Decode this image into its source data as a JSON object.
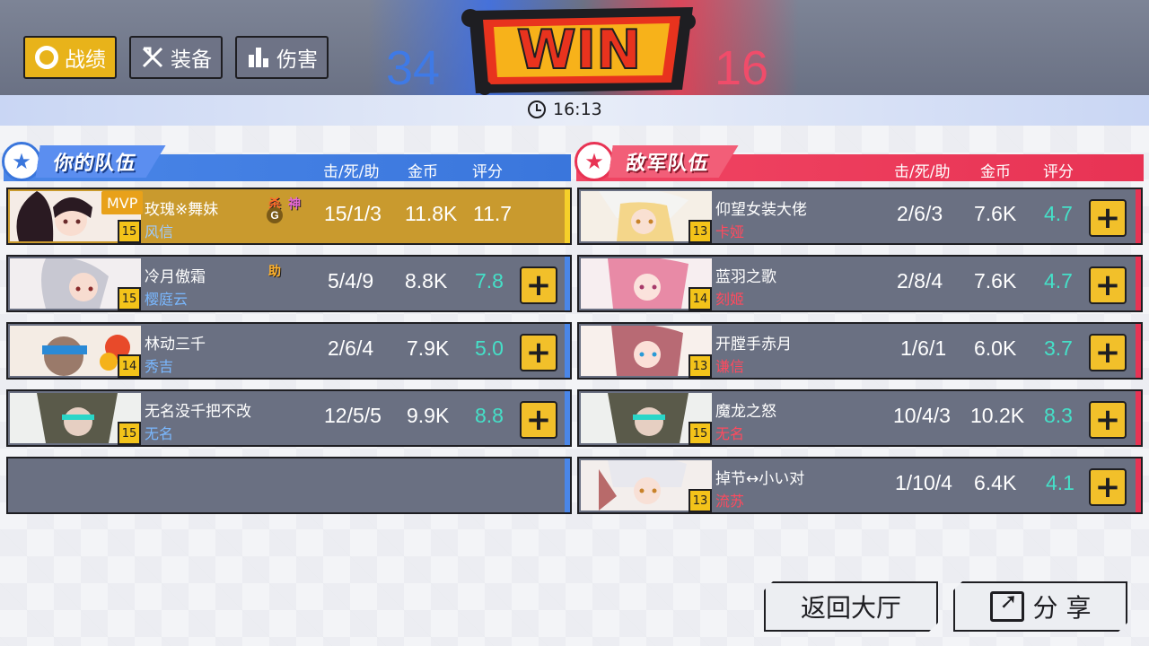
{
  "tabs": [
    {
      "label": "战绩",
      "icon": "ring-icon",
      "active": true
    },
    {
      "label": "装备",
      "icon": "equipment-icon",
      "active": false
    },
    {
      "label": "伤害",
      "icon": "bar-chart-icon",
      "active": false
    }
  ],
  "score": {
    "blue": "34",
    "red": "16",
    "result": "WIN"
  },
  "timer": "16:13",
  "columns": {
    "kda": "击/死/助",
    "gold": "金币",
    "rating": "评分"
  },
  "my_team": {
    "title": "你的队伍",
    "players": [
      {
        "name": "玫瑰※舞妹",
        "hero": "风信",
        "level": "15",
        "kda": "15/1/3",
        "gold": "11.8K",
        "rating": "11.7",
        "mvp": "MVP",
        "badges": [
          "杀",
          "G",
          "神"
        ]
      },
      {
        "name": "冷月傲霜",
        "hero": "樱庭云",
        "level": "15",
        "kda": "5/4/9",
        "gold": "8.8K",
        "rating": "7.8",
        "badges": [
          "助"
        ]
      },
      {
        "name": "林动三千",
        "hero": "秀吉",
        "level": "14",
        "kda": "2/6/4",
        "gold": "7.9K",
        "rating": "5.0",
        "badges": []
      },
      {
        "name": "无名没千把不改",
        "hero": "无名",
        "level": "15",
        "kda": "12/5/5",
        "gold": "9.9K",
        "rating": "8.8",
        "badges": []
      }
    ]
  },
  "enemy_team": {
    "title": "敌军队伍",
    "players": [
      {
        "name": "仰望女装大佬",
        "hero": "卡娅",
        "level": "13",
        "kda": "2/6/3",
        "gold": "7.6K",
        "rating": "4.7"
      },
      {
        "name": "蓝羽之歌",
        "hero": "刻姬",
        "level": "14",
        "kda": "2/8/4",
        "gold": "7.6K",
        "rating": "4.7"
      },
      {
        "name": "开膛手赤月",
        "hero": "谦信",
        "level": "13",
        "kda": "1/6/1",
        "gold": "6.0K",
        "rating": "3.7"
      },
      {
        "name": "魔龙之怒",
        "hero": "无名",
        "level": "15",
        "kda": "10/4/3",
        "gold": "10.2K",
        "rating": "8.3"
      },
      {
        "name": "掉节↔小い对",
        "hero": "流苏",
        "level": "13",
        "kda": "1/10/4",
        "gold": "6.4K",
        "rating": "4.1"
      }
    ]
  },
  "add_button_label": "+",
  "buttons": {
    "lobby": "返回大厅",
    "share": "分 享"
  },
  "colors": {
    "blue_team": "#4a86e8",
    "red_team": "#e83354",
    "accent": "#f2c02a",
    "rating": "#45e0c8"
  }
}
